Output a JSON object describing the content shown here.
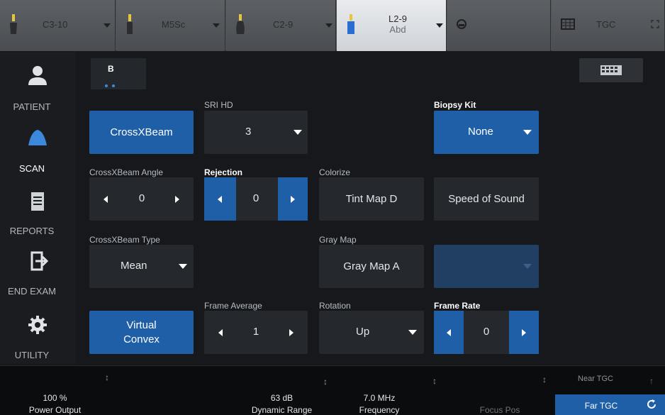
{
  "probes": [
    {
      "name": "C3-10"
    },
    {
      "name": "M5Sc"
    },
    {
      "name": "C2-9"
    },
    {
      "name": "L2-9",
      "preset": "Abd"
    }
  ],
  "top_right": {
    "tgc_label": "TGC"
  },
  "nav": [
    {
      "label": "PATIENT"
    },
    {
      "label": "SCAN"
    },
    {
      "label": "REPORTS"
    },
    {
      "label": "END EXAM"
    },
    {
      "label": "UTILITY"
    }
  ],
  "tab": {
    "label": "B"
  },
  "controls": {
    "crossxbeam_button": "CrossXBeam",
    "sri_hd": {
      "label": "SRI HD",
      "value": "3"
    },
    "biopsy_kit": {
      "label": "Biopsy Kit",
      "value": "None"
    },
    "crossxbeam_angle": {
      "label": "CrossXBeam Angle",
      "value": "0"
    },
    "rejection": {
      "label": "Rejection",
      "value": "0"
    },
    "colorize": {
      "label": "Colorize",
      "value": "Tint Map D"
    },
    "speed_of_sound": "Speed of Sound",
    "crossxbeam_type": {
      "label": "CrossXBeam Type",
      "value": "Mean"
    },
    "gray_map": {
      "label": "Gray Map",
      "value": "Gray Map A"
    },
    "virtual_convex": {
      "line1": "Virtual",
      "line2": "Convex"
    },
    "frame_average": {
      "label": "Frame Average",
      "value": "1"
    },
    "rotation": {
      "label": "Rotation",
      "value": "Up"
    },
    "frame_rate": {
      "label": "Frame Rate",
      "value": "0"
    }
  },
  "bottom": {
    "power_output": {
      "value": "100 %",
      "label": "Power Output"
    },
    "dynamic_range": {
      "value": "63 dB",
      "label": "Dynamic Range"
    },
    "frequency": {
      "value": "7.0 MHz",
      "label": "Frequency"
    },
    "focus_pos": {
      "label": "Focus Pos"
    },
    "near_tgc": "Near TGC",
    "far_tgc": "Far TGC"
  },
  "colors": {
    "accent": "#1f5fa8",
    "background": "#16181c",
    "probe_bar": "#4f5256"
  }
}
